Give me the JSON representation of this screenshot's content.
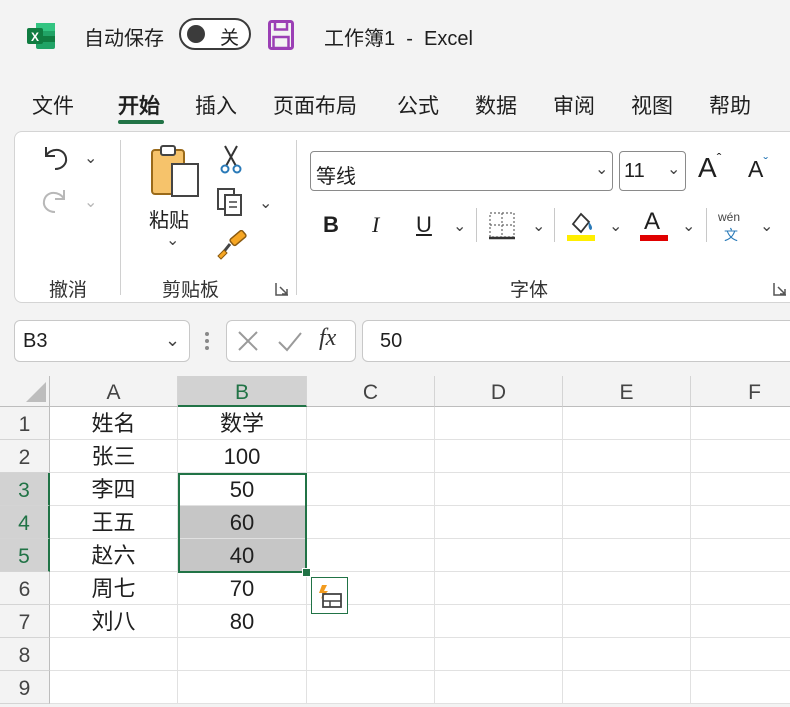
{
  "titlebar": {
    "autosave_label": "自动保存",
    "autosave_state": "关",
    "doc_title": "工作簿1  -  Excel"
  },
  "tabs": [
    "文件",
    "开始",
    "插入",
    "页面布局",
    "公式",
    "数据",
    "审阅",
    "视图",
    "帮助"
  ],
  "ribbon": {
    "undo_group_label": "撤消",
    "paste_label": "粘贴",
    "clipboard_group_label": "剪贴板",
    "font_name": "等线",
    "font_size": "11",
    "font_group_label": "字体",
    "bold": "B",
    "italic": "I",
    "underline": "U",
    "grow_font": "A",
    "shrink_font": "A",
    "font_color_letter": "A",
    "phonetic_top": "wén",
    "phonetic_bottom": "文",
    "font_color_hex": "#e00000",
    "highlight_color_hex": "#ffee00"
  },
  "formula_bar": {
    "name_box": "B3",
    "fx": "fx",
    "value": "50"
  },
  "grid": {
    "columns": [
      "A",
      "B",
      "C",
      "D",
      "E",
      "F"
    ],
    "selected_column": "B",
    "rows": [
      "1",
      "2",
      "3",
      "4",
      "5",
      "6",
      "7",
      "8",
      "9"
    ],
    "selected_rows": [
      "3",
      "4",
      "5"
    ],
    "cells": [
      [
        "姓名",
        "数学"
      ],
      [
        "张三",
        "100"
      ],
      [
        "李四",
        "50"
      ],
      [
        "王五",
        "60"
      ],
      [
        "赵六",
        "40"
      ],
      [
        "周七",
        "70"
      ],
      [
        "刘八",
        "80"
      ]
    ],
    "active_cell": "B3",
    "selection_range": "B3:B5",
    "accent_color": "#217346"
  }
}
